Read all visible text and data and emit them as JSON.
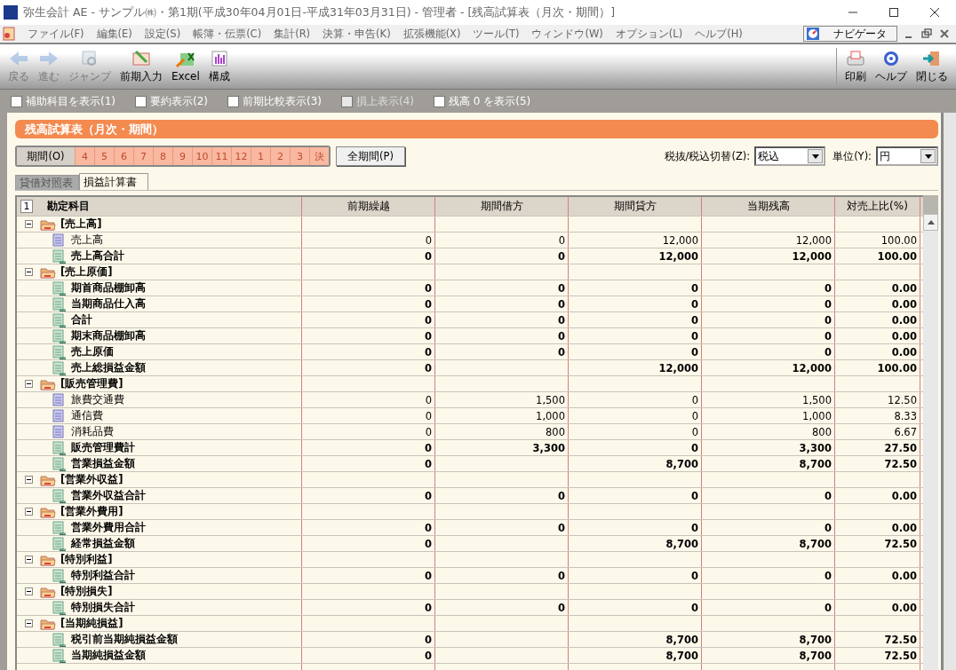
{
  "window": {
    "title": "弥生会計 AE - サンプル㈱・第1期(平成30年04月01日-平成31年03月31日) - 管理者 - [残高試算表（月次・期間）]"
  },
  "menu": [
    "ファイル(F)",
    "編集(E)",
    "設定(S)",
    "帳簿・伝票(C)",
    "集計(R)",
    "決算・申告(K)",
    "拡張機能(X)",
    "ツール(T)",
    "ウィンドウ(W)",
    "オプション(L)",
    "ヘルプ(H)"
  ],
  "navigator": {
    "label": "ナビゲータ"
  },
  "toolbar_left": [
    {
      "label": "戻る",
      "kind": "back",
      "disabled": true
    },
    {
      "label": "進む",
      "kind": "forward",
      "disabled": true
    },
    {
      "label": "ジャンプ",
      "kind": "jump",
      "disabled": true
    },
    {
      "label": "前期入力",
      "kind": "prior",
      "disabled": false
    },
    {
      "label": "Excel",
      "kind": "excel",
      "disabled": false
    },
    {
      "label": "構成",
      "kind": "layout",
      "disabled": false
    }
  ],
  "toolbar_right": [
    {
      "label": "印刷",
      "kind": "print"
    },
    {
      "label": "ヘルプ",
      "kind": "help"
    },
    {
      "label": "閉じる",
      "kind": "close"
    }
  ],
  "options": [
    {
      "label": "補助科目を表示(1)",
      "checked": false,
      "disabled": false
    },
    {
      "label": "要約表示(2)",
      "checked": false,
      "disabled": false
    },
    {
      "label": "前期比較表示(3)",
      "checked": false,
      "disabled": false
    },
    {
      "label": "損上表示(4)",
      "checked": false,
      "disabled": true
    },
    {
      "label": "残高 0 を表示(5)",
      "checked": false,
      "disabled": false
    }
  ],
  "report_title": "残高試算表（月次・期間）",
  "period": {
    "label": "期間(O)",
    "months": [
      "4",
      "5",
      "6",
      "7",
      "8",
      "9",
      "10",
      "11",
      "12",
      "1",
      "2",
      "3",
      "決"
    ],
    "all_button": "全期間(P)"
  },
  "tax": {
    "label": "税抜/税込切替(Z):",
    "value": "税込"
  },
  "unit": {
    "label": "単位(Y):",
    "value": "円"
  },
  "tabs": [
    {
      "label": "貸借対照表",
      "selected": false
    },
    {
      "label": "損益計算書",
      "selected": true
    }
  ],
  "table": {
    "level_button": "1",
    "columns": [
      "勘定科目",
      "前期繰越",
      "期間借方",
      "期間貸方",
      "当期残高",
      "対売上比(%)"
    ],
    "groups": [
      {
        "name": "[売上高]",
        "expanded": true,
        "children": [
          {
            "name": "売上高",
            "kind": "account",
            "values": {
              "prior": "0",
              "debit": "0",
              "credit": "12,000",
              "balance": "12,000",
              "ratio": "100.00"
            }
          },
          {
            "name": "売上高合計",
            "kind": "total",
            "values": {
              "prior": "0",
              "debit": "0",
              "credit": "12,000",
              "balance": "12,000",
              "ratio": "100.00"
            }
          }
        ]
      },
      {
        "name": "[売上原価]",
        "expanded": true,
        "children": [
          {
            "name": "期首商品棚卸高",
            "kind": "total",
            "values": {
              "prior": "0",
              "debit": "0",
              "credit": "0",
              "balance": "0",
              "ratio": "0.00"
            }
          },
          {
            "name": "当期商品仕入高",
            "kind": "total",
            "values": {
              "prior": "0",
              "debit": "0",
              "credit": "0",
              "balance": "0",
              "ratio": "0.00"
            }
          },
          {
            "name": "合計",
            "kind": "total",
            "values": {
              "prior": "0",
              "debit": "0",
              "credit": "0",
              "balance": "0",
              "ratio": "0.00"
            }
          },
          {
            "name": "期末商品棚卸高",
            "kind": "total",
            "values": {
              "prior": "0",
              "debit": "0",
              "credit": "0",
              "balance": "0",
              "ratio": "0.00"
            }
          },
          {
            "name": "売上原価",
            "kind": "total",
            "values": {
              "prior": "0",
              "debit": "0",
              "credit": "0",
              "balance": "0",
              "ratio": "0.00"
            }
          },
          {
            "name": "売上総損益金額",
            "kind": "total",
            "values": {
              "prior": "0",
              "credit": "12,000",
              "balance": "12,000",
              "ratio": "100.00"
            }
          }
        ]
      },
      {
        "name": "[販売管理費]",
        "expanded": true,
        "children": [
          {
            "name": "旅費交通費",
            "kind": "account",
            "values": {
              "prior": "0",
              "debit": "1,500",
              "credit": "0",
              "balance": "1,500",
              "ratio": "12.50"
            }
          },
          {
            "name": "通信費",
            "kind": "account",
            "values": {
              "prior": "0",
              "debit": "1,000",
              "credit": "0",
              "balance": "1,000",
              "ratio": "8.33"
            }
          },
          {
            "name": "消耗品費",
            "kind": "account",
            "values": {
              "prior": "0",
              "debit": "800",
              "credit": "0",
              "balance": "800",
              "ratio": "6.67"
            }
          },
          {
            "name": "販売管理費計",
            "kind": "total",
            "values": {
              "prior": "0",
              "debit": "3,300",
              "credit": "0",
              "balance": "3,300",
              "ratio": "27.50"
            }
          },
          {
            "name": "営業損益金額",
            "kind": "total",
            "values": {
              "prior": "0",
              "credit": "8,700",
              "balance": "8,700",
              "ratio": "72.50"
            }
          }
        ]
      },
      {
        "name": "[営業外収益]",
        "expanded": true,
        "children": [
          {
            "name": "営業外収益合計",
            "kind": "total",
            "values": {
              "prior": "0",
              "debit": "0",
              "credit": "0",
              "balance": "0",
              "ratio": "0.00"
            }
          }
        ]
      },
      {
        "name": "[営業外費用]",
        "expanded": true,
        "children": [
          {
            "name": "営業外費用合計",
            "kind": "total",
            "values": {
              "prior": "0",
              "debit": "0",
              "credit": "0",
              "balance": "0",
              "ratio": "0.00"
            }
          },
          {
            "name": "経常損益金額",
            "kind": "total",
            "values": {
              "prior": "0",
              "credit": "8,700",
              "balance": "8,700",
              "ratio": "72.50"
            }
          }
        ]
      },
      {
        "name": "[特別利益]",
        "expanded": true,
        "children": [
          {
            "name": "特別利益合計",
            "kind": "total",
            "values": {
              "prior": "0",
              "debit": "0",
              "credit": "0",
              "balance": "0",
              "ratio": "0.00"
            }
          }
        ]
      },
      {
        "name": "[特別損失]",
        "expanded": true,
        "children": [
          {
            "name": "特別損失合計",
            "kind": "total",
            "values": {
              "prior": "0",
              "debit": "0",
              "credit": "0",
              "balance": "0",
              "ratio": "0.00"
            }
          }
        ]
      },
      {
        "name": "[当期純損益]",
        "expanded": true,
        "children": [
          {
            "name": "税引前当期純損益金額",
            "kind": "total",
            "values": {
              "prior": "0",
              "credit": "8,700",
              "balance": "8,700",
              "ratio": "72.50"
            }
          },
          {
            "name": "当期純損益金額",
            "kind": "total",
            "values": {
              "prior": "0",
              "credit": "8,700",
              "balance": "8,700",
              "ratio": "72.50"
            }
          }
        ]
      }
    ]
  }
}
